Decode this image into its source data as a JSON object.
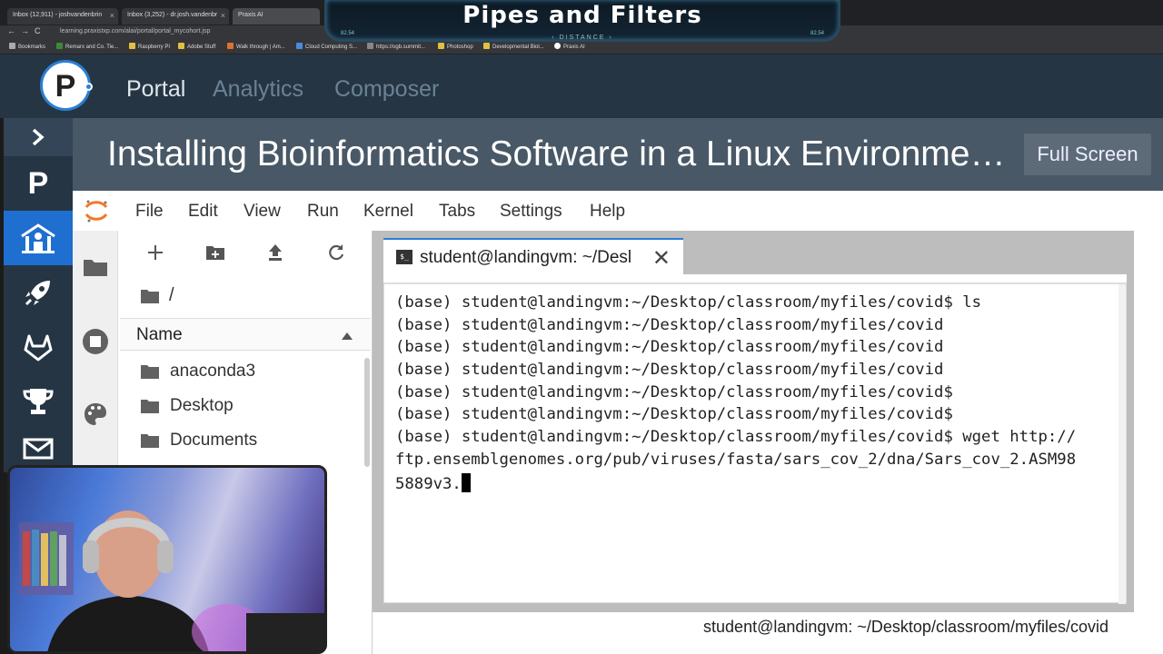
{
  "browser": {
    "tabs": [
      {
        "label": "Inbox (12,911) - joshvandenbrin"
      },
      {
        "label": "Inbox (3,252) - dr.josh.vandenbr"
      },
      {
        "label": "Praxis AI"
      }
    ],
    "url": "learning.praxistxp.com/alai/portal/portal_mycohort.jsp",
    "bookmarks": [
      "Bookmarks",
      "Remarx and Co. Tie...",
      "Raspberry PI",
      "Adobe Stuff",
      "Walk through | Am...",
      "Cloud Computing S...",
      "https://ogb.summit...",
      "Photoshop",
      "Developmental Biol...",
      "Praxis AI"
    ]
  },
  "banner": {
    "title": "Pipes and Filters",
    "subtitle": "DISTANCE",
    "left_num": "82.54",
    "right_num": "82.54"
  },
  "portal": {
    "logo_letter": "P",
    "nav": [
      "Portal",
      "Analytics",
      "Composer"
    ]
  },
  "sidebar": {
    "items": [
      "chevron-right",
      "praxis",
      "cohort",
      "rocket",
      "gitlab",
      "trophy",
      "mail"
    ]
  },
  "course": {
    "title": "Installing Bioinformatics Software in a Linux Environme…",
    "fullscreen_label": "Full Screen"
  },
  "jupyter": {
    "menu": [
      "File",
      "Edit",
      "View",
      "Run",
      "Kernel",
      "Tabs",
      "Settings",
      "Help"
    ],
    "filebrowser": {
      "crumb": "/",
      "column_header": "Name",
      "items": [
        "anaconda3",
        "Desktop",
        "Documents"
      ]
    },
    "terminal": {
      "tab_label": "student@landingvm: ~/Desl",
      "tab_icon": "$_",
      "lines": [
        "(base) student@landingvm:~/Desktop/classroom/myfiles/covid$ ls",
        "(base) student@landingvm:~/Desktop/classroom/myfiles/covid",
        "(base) student@landingvm:~/Desktop/classroom/myfiles/covid",
        "(base) student@landingvm:~/Desktop/classroom/myfiles/covid",
        "(base) student@landingvm:~/Desktop/classroom/myfiles/covid$",
        "(base) student@landingvm:~/Desktop/classroom/myfiles/covid$",
        "(base) student@landingvm:~/Desktop/classroom/myfiles/covid$ wget http://",
        "ftp.ensemblgenomes.org/pub/viruses/fasta/sars_cov_2/dna/Sars_cov_2.ASM98",
        "5889v3."
      ]
    },
    "status": "student@landingvm: ~/Desktop/classroom/myfiles/covid"
  }
}
